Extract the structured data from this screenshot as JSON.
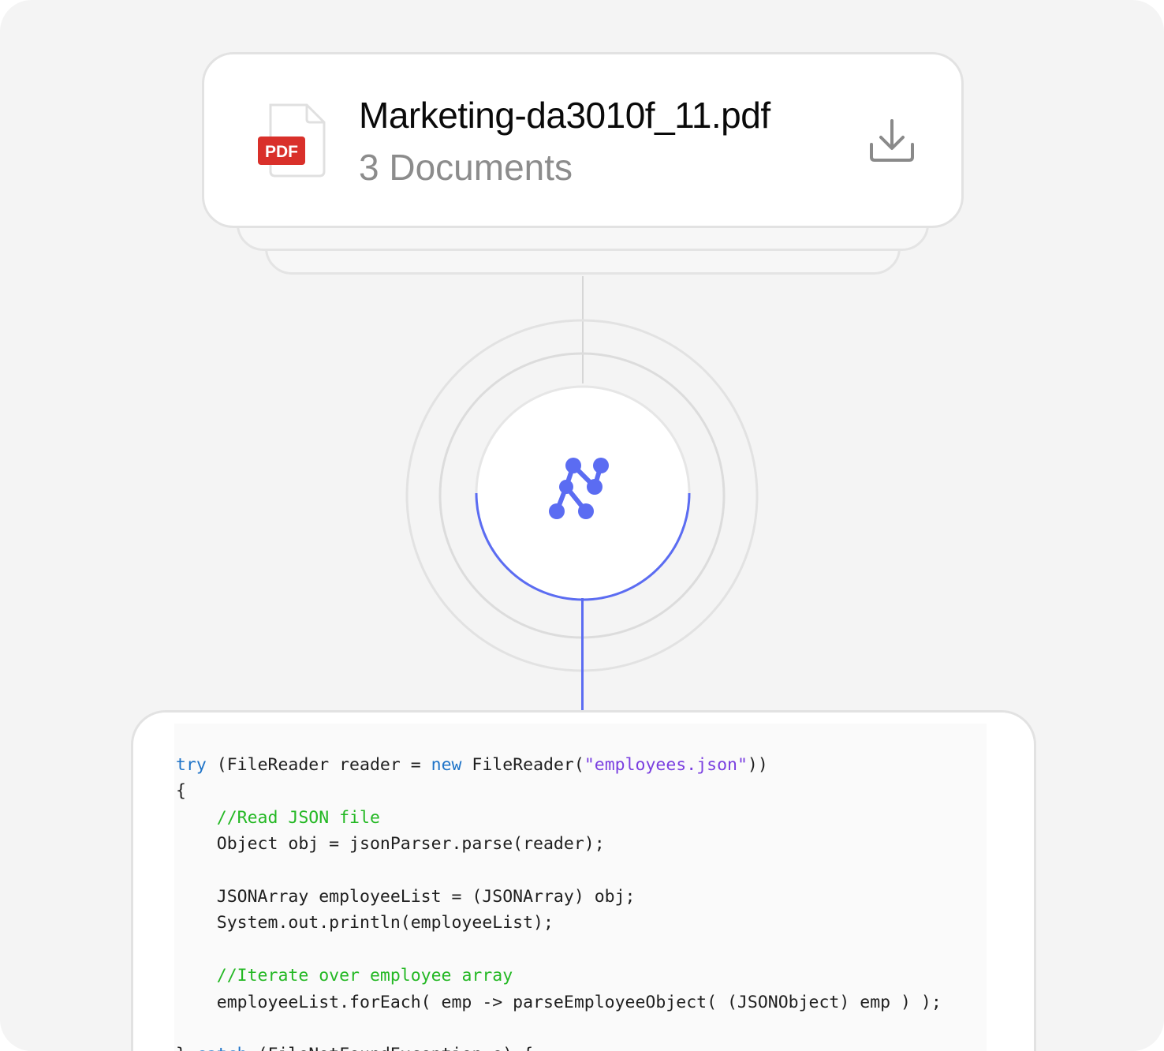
{
  "file": {
    "name": "Marketing-da3010f_11.pdf",
    "subtitle": "3 Documents",
    "badge": "PDF",
    "icon": "pdf-file-icon",
    "action_icon": "download-icon"
  },
  "hub": {
    "icon": "network-nodes-logo-icon",
    "accent": "#5b6cf2"
  },
  "code": {
    "language": "java",
    "lines": [
      [
        {
          "t": "try",
          "c": "kw"
        },
        {
          "t": " (FileReader reader = "
        },
        {
          "t": "new",
          "c": "kw"
        },
        {
          "t": " FileReader("
        },
        {
          "t": "\"employees.json\"",
          "c": "str"
        },
        {
          "t": "))"
        }
      ],
      [
        {
          "t": "{"
        }
      ],
      [
        {
          "t": "    "
        },
        {
          "t": "//Read JSON file",
          "c": "cm"
        }
      ],
      [
        {
          "t": "    Object obj = jsonParser.parse(reader);"
        }
      ],
      [
        {
          "t": ""
        }
      ],
      [
        {
          "t": "    JSONArray employeeList = (JSONArray) obj;"
        }
      ],
      [
        {
          "t": "    System.out.println(employeeList);"
        }
      ],
      [
        {
          "t": ""
        }
      ],
      [
        {
          "t": "    "
        },
        {
          "t": "//Iterate over employee array",
          "c": "cm"
        }
      ],
      [
        {
          "t": "    employeeList.forEach( emp -> parseEmployeeObject( (JSONObject) emp ) );"
        }
      ],
      [
        {
          "t": ""
        }
      ],
      [
        {
          "t": "} "
        },
        {
          "t": "catch",
          "c": "kw"
        },
        {
          "t": " (FileNotFoundException e) {"
        }
      ]
    ]
  }
}
